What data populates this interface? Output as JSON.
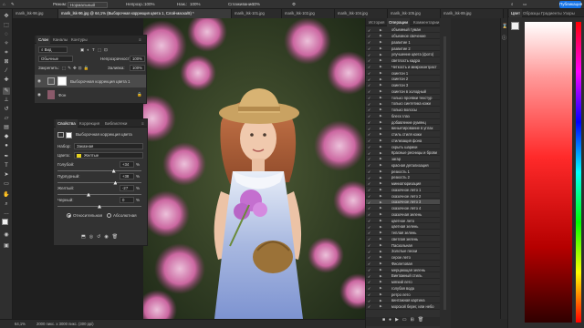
{
  "options_bar": {
    "mode_label": "Режим:",
    "mode_value": "Нормальный",
    "opacity_label": "Непрозр.:",
    "opacity_value": "100%",
    "flow_label": "Наж.:",
    "flow_value": "100%",
    "smoothing_label": "Сглаживание:",
    "smoothing_value": "10%",
    "share_label": "Публикация"
  },
  "tabs": [
    "marik_lsk-98.jpg",
    "marik_lsk-96.jpg @ 64,1% (Выборочная коррекция цвета 1, Слой-маска/8) *",
    "marik_lsk-101.jpg",
    "marik_lsk-102.jpg",
    "marik_lsk-104.jpg",
    "marik_lsk-105.jpg",
    "marik_lsk-89.jpg"
  ],
  "status_bar": {
    "zoom": "64,1%",
    "doc_info": "2000 пикс. x 3000 пикс. (300 ppi)"
  },
  "layers_panel": {
    "tabs": [
      "Слои",
      "Каналы",
      "Контуры"
    ],
    "kind_filter": "Вид",
    "blend_mode": "Обычные",
    "opacity_label": "Непрозрачность:",
    "opacity_value": "100%",
    "lock_label": "Закрепить:",
    "fill_label": "Заливка:",
    "fill_value": "100%",
    "layers": [
      {
        "name": "Выборочная коррекция цвета 1",
        "type": "adjustment"
      },
      {
        "name": "Фон",
        "type": "background"
      }
    ]
  },
  "properties_panel": {
    "tabs": [
      "Свойства",
      "Коррекция",
      "Библиотеки"
    ],
    "title": "Выборочная коррекция цвета",
    "preset_label": "Набор:",
    "preset_value": "Заказная",
    "colors_label": "Цвета:",
    "colors_value": "Желтые",
    "sliders": [
      {
        "label": "Голубой:",
        "value": "+34",
        "pct": 0.67
      },
      {
        "label": "Пурпурный:",
        "value": "+38",
        "pct": 0.69
      },
      {
        "label": "Желтый:",
        "value": "-27",
        "pct": 0.37
      },
      {
        "label": "Черный:",
        "value": "0",
        "pct": 0.5
      }
    ],
    "pct_sign": "%",
    "radio_relative": "Относительная",
    "radio_absolute": "Абсолютная"
  },
  "history_panel": {
    "tabs": [
      "История",
      "Операции",
      "Комментарии"
    ],
    "actions": [
      "объемный туман",
      "объемное свечение",
      "развитие 1",
      "развитие 2",
      "улучшение цвета (фото)",
      "светлость кадра",
      "Четкость и микроконтраст",
      "скинтон 1",
      "скинтон 2",
      "скинтон 3",
      "скинтон в холодный",
      "только проявки текстур",
      "только синтетика кожи",
      "только волосы",
      "блеск глаз",
      "добавление румянц",
      "виньетирование в углах",
      "стиль стиля кожи",
      "стилизация фона",
      "скрыть шарики",
      "Красные ресницы и брови",
      "загар",
      "красная детализация",
      "резкость 1",
      "резкость 2",
      "миниатюризация",
      "сказочное лето 1",
      "сказочное лето 2",
      "сказочное лето 3",
      "сказочное лето 4",
      "сказочная зелень",
      "цветное лето",
      "цветная зелень",
      "теплая зелень",
      "светлая зелень",
      "Пасхальная",
      "Золотые пески",
      "серое лето",
      "Фиолетовая",
      "мерцающая зелень",
      "Винтажный стиль",
      "мягкий лето",
      "голубая вода",
      "ретро лето",
      "винтажная картина",
      "морской берег, или небо"
    ],
    "selected_index": 28
  },
  "right_column": {
    "tabs": [
      "Цвет",
      "Образцы",
      "Градиенты",
      "Узоры"
    ],
    "fg_color": "#f2f2f2",
    "bg_color": "#111111"
  },
  "colors": {
    "accent": "#1473e6",
    "panel": "#323232",
    "bg": "#282828"
  }
}
